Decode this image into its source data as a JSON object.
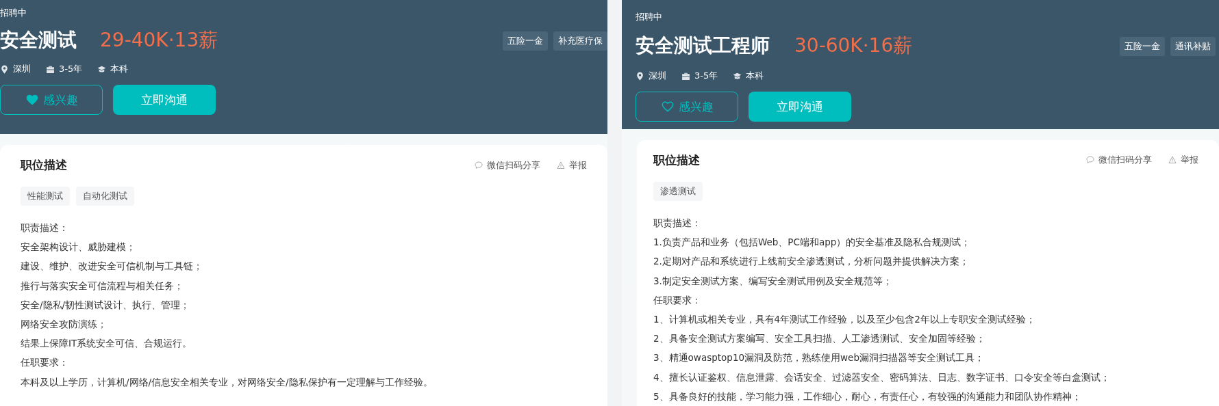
{
  "jobs": [
    {
      "status": "招聘中",
      "title": "安全测试",
      "salary": "29-40K·13薪",
      "benefits": [
        "五险一金",
        "补充医疗保"
      ],
      "city": "深圳",
      "experience": "3-5年",
      "degree": "本科",
      "interest_button": {
        "label": "感兴趣",
        "interested": true
      },
      "chat_button": "立即沟通",
      "card": {
        "heading": "职位描述",
        "share": "微信扫码分享",
        "report": "举报",
        "tags": [
          "性能测试",
          "自动化测试"
        ],
        "lines": [
          "职责描述：",
          "安全架构设计、威胁建模；",
          "建设、维护、改进安全可信机制与工具链；",
          "推行与落实安全可信流程与相关任务；",
          "安全/隐私/韧性测试设计、执行、管理；",
          "网络安全攻防演练；",
          "结果上保障IT系统安全可信、合规运行。",
          "任职要求：",
          "本科及以上学历，计算机/网络/信息安全相关专业，对网络安全/隐私保护有一定理解与工作经验。"
        ]
      }
    },
    {
      "status": "招聘中",
      "title": "安全测试工程师",
      "salary": "30-60K·16薪",
      "benefits": [
        "五险一金",
        "通讯补贴"
      ],
      "city": "深圳",
      "experience": "3-5年",
      "degree": "本科",
      "interest_button": {
        "label": "感兴趣",
        "interested": false
      },
      "chat_button": "立即沟通",
      "card": {
        "heading": "职位描述",
        "share": "微信扫码分享",
        "report": "举报",
        "tags": [
          "渗透测试"
        ],
        "lines": [
          "职责描述：",
          "1.负责产品和业务（包括Web、PC端和app）的安全基准及隐私合规测试；",
          "2.定期对产品和系统进行上线前安全渗透测试，分析问题并提供解决方案；",
          "3.制定安全测试方案、编写安全测试用例及安全规范等；",
          "任职要求：",
          "1、计算机或相关专业，具有4年测试工作经验，以及至少包含2年以上专职安全测试经验；",
          "2、具备安全测试方案编写、安全工具扫描、人工渗透测试、安全加固等经验；",
          "3、精通owasptop10漏洞及防范，熟练使用web漏洞扫描器等安全测试工具；",
          "4、擅长认证鉴权、信息泄露、会话安全、过滤器安全、密码算法、日志、数字证书、口令安全等白盒测试；",
          "5、具备良好的技能，学习能力强，工作细心，耐心，有责任心，有较强的沟通能力和团队协作精神；"
        ]
      }
    }
  ]
}
